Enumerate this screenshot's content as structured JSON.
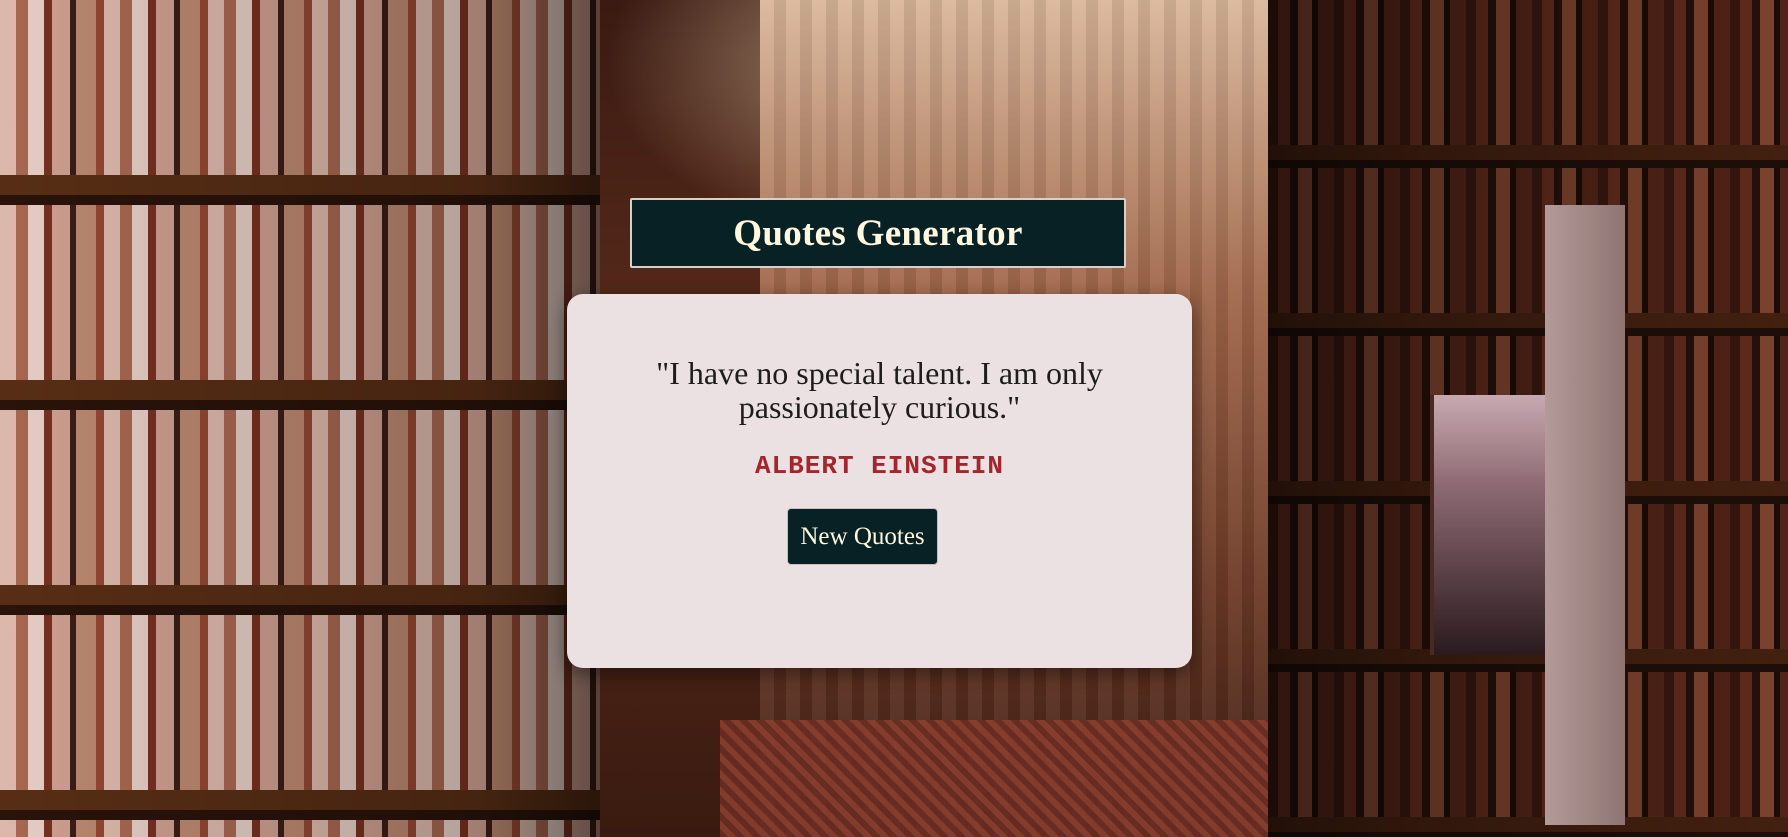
{
  "app": {
    "title": "Quotes Generator"
  },
  "quote": {
    "text": "\"I have no special talent. I am only passionately curious.\"",
    "author": "ALBERT EINSTEIN"
  },
  "actions": {
    "new_quote_label": "New Quotes"
  },
  "colors": {
    "title_bg": "#082125",
    "title_text": "#fff7df",
    "card_bg": "#ebe1e2",
    "author_text": "#a3262c",
    "button_bg": "#082125"
  }
}
